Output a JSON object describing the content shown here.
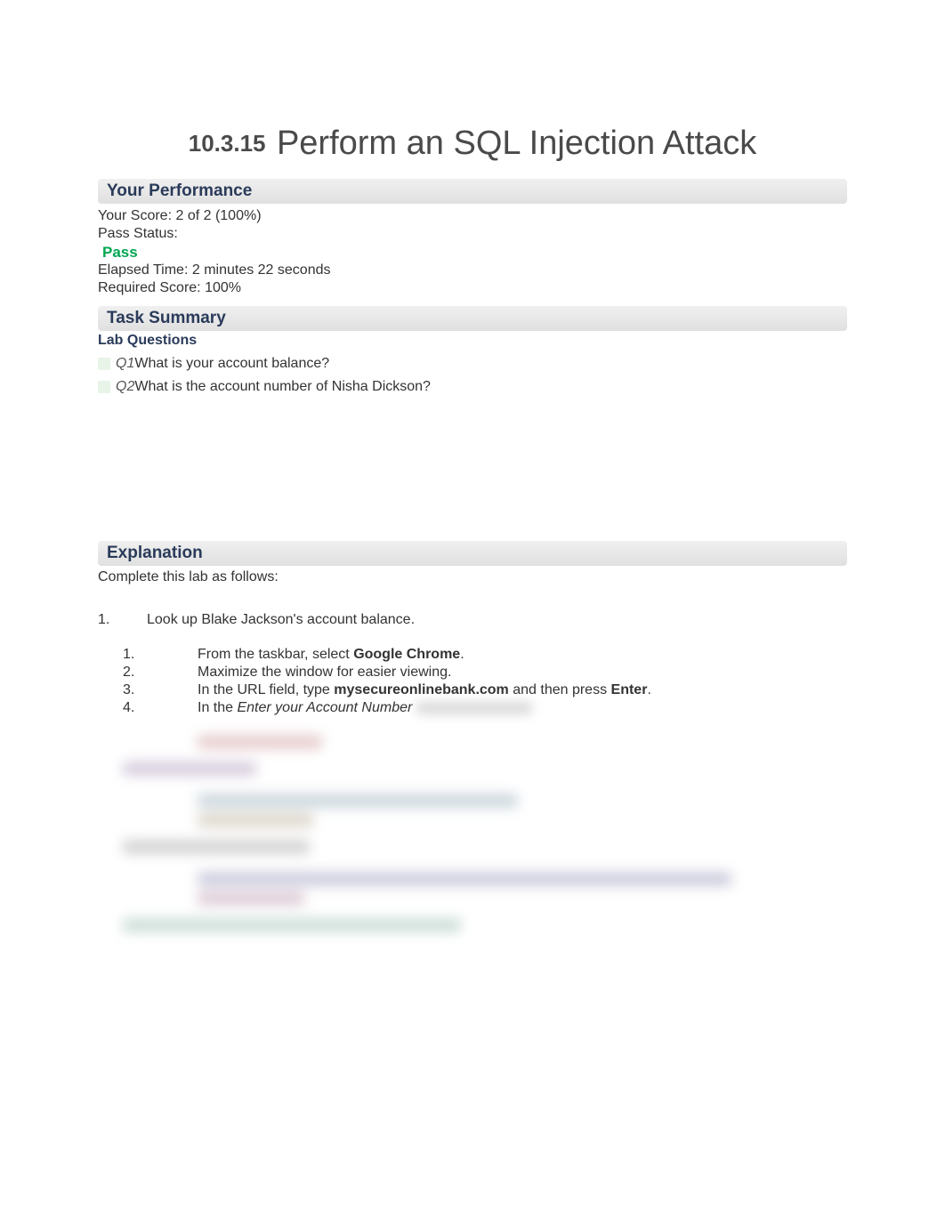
{
  "title": {
    "number": "10.3.15",
    "text": "Perform an SQL Injection Attack"
  },
  "performance": {
    "header": "Your Performance",
    "score_label": "Your Score:",
    "score_value": "2 of 2 (100%)",
    "pass_label": "Pass Status:",
    "pass_value": "Pass",
    "elapsed_label": "Elapsed Time:",
    "elapsed_value": "2 minutes 22 seconds",
    "required_label": "Required Score:",
    "required_value": "100%"
  },
  "task_summary": {
    "header": "Task Summary",
    "sub_header": "Lab Questions",
    "questions": [
      {
        "id": "Q1",
        "text": "What is your account balance?"
      },
      {
        "id": "Q2",
        "text": "What is the account number of Nisha Dickson?"
      }
    ]
  },
  "explanation": {
    "header": "Explanation",
    "intro": "Complete this lab as follows:",
    "main_steps": [
      {
        "num": "1.",
        "text": "Look up Blake Jackson's account balance.",
        "sub": [
          {
            "num": "1.",
            "pre": "From the taskbar, select ",
            "bold": "Google Chrome",
            "post": "."
          },
          {
            "num": "2.",
            "pre": "Maximize the window for easier viewing.",
            "bold": "",
            "post": ""
          },
          {
            "num": "3.",
            "pre": "In the URL field, type ",
            "bold": "mysecureonlinebank.com",
            "post": " and then press ",
            "bold2": "Enter",
            "post2": "."
          },
          {
            "num": "4.",
            "pre": "In the ",
            "italic": "Enter your Account Number",
            "post": ""
          }
        ]
      }
    ]
  }
}
